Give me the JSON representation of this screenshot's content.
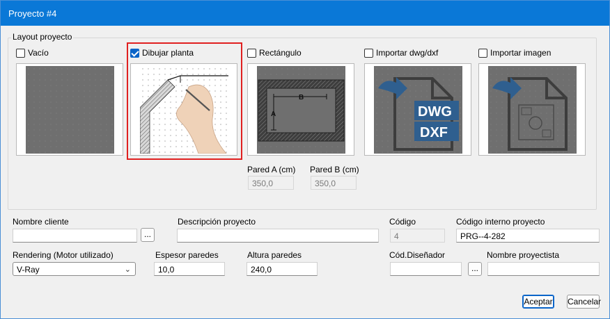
{
  "window": {
    "title": "Proyecto #4"
  },
  "layout_group": {
    "legend": "Layout proyecto",
    "options": [
      {
        "label": "Vacío",
        "checked": false
      },
      {
        "label": "Dibujar planta",
        "checked": true
      },
      {
        "label": "Rectángulo",
        "checked": false
      },
      {
        "label": "Importar dwg/dxf",
        "checked": false
      },
      {
        "label": "Importar imagen",
        "checked": false
      }
    ],
    "rect_labels": {
      "a": "A",
      "b": "B"
    },
    "dwg_labels": {
      "dwg": "DWG",
      "dxf": "DXF"
    },
    "wall_a": {
      "label": "Pared A (cm)",
      "value": "350,0"
    },
    "wall_b": {
      "label": "Pared B (cm)",
      "value": "350,0"
    }
  },
  "form": {
    "client_name": {
      "label": "Nombre cliente",
      "value": ""
    },
    "browse_label": "...",
    "description": {
      "label": "Descripción proyecto",
      "value": ""
    },
    "code": {
      "label": "Código",
      "value": "4"
    },
    "internal_code": {
      "label": "Código interno proyecto",
      "value": "PRG--4-282"
    },
    "rendering": {
      "label": "Rendering (Motor utilizado)",
      "value": "V-Ray"
    },
    "wall_thickness": {
      "label": "Espesor paredes",
      "value": "10,0"
    },
    "wall_height": {
      "label": "Altura paredes",
      "value": "240,0"
    },
    "designer_code": {
      "label": "Cód.Diseñador",
      "value": ""
    },
    "designer_name": {
      "label": "Nombre proyectista",
      "value": ""
    }
  },
  "buttons": {
    "accept": "Aceptar",
    "cancel": "Cancelar"
  },
  "colors": {
    "accent": "#0a78d7",
    "selection": "#e02020",
    "thumb_bg": "#707070",
    "dwg_blue": "#2f5f8f"
  }
}
